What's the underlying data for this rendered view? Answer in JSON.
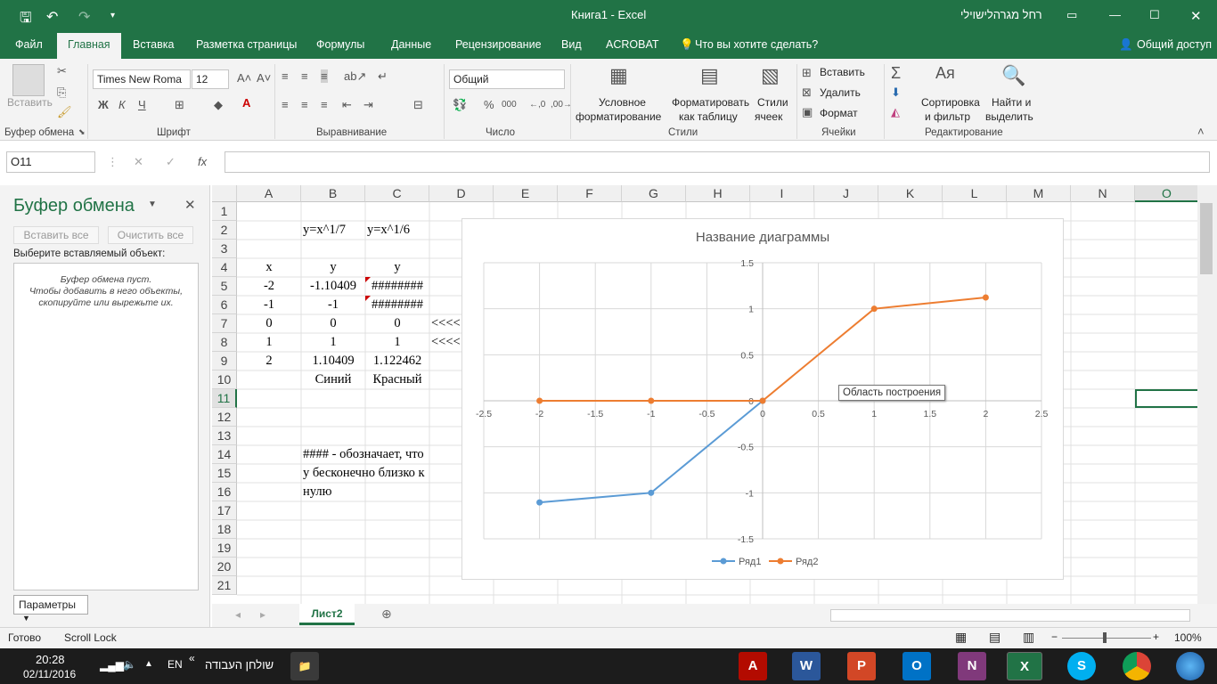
{
  "window": {
    "title": "Книга1  -  Excel",
    "user": "רחל מגרהלישוילי"
  },
  "tabs": [
    "Файл",
    "Главная",
    "Вставка",
    "Разметка страницы",
    "Формулы",
    "Данные",
    "Рецензирование",
    "Вид",
    "ACROBAT"
  ],
  "tell_me": "Что вы хотите сделать?",
  "share": "Общий доступ",
  "ribbon": {
    "paste": "Вставить",
    "font_name": "Times New Roma",
    "font_size": "12",
    "bold": "Ж",
    "italic": "К",
    "underline": "Ч",
    "number_format": "Общий",
    "cond_format_1": "Условное",
    "cond_format_2": "форматирование",
    "format_table_1": "Форматировать",
    "format_table_2": "как таблицу",
    "cell_styles_1": "Стили",
    "cell_styles_2": "ячеек",
    "insert": "Вставить",
    "delete": "Удалить",
    "format": "Формат",
    "sort_1": "Сортировка",
    "sort_2": "и фильтр",
    "find_1": "Найти и",
    "find_2": "выделить",
    "groups": {
      "clipboard": "Буфер обмена",
      "font": "Шрифт",
      "alignment": "Выравнивание",
      "number": "Число",
      "styles": "Стили",
      "cells": "Ячейки",
      "editing": "Редактирование"
    }
  },
  "namebox": "O11",
  "formula": "",
  "clipboard_pane": {
    "title": "Буфер обмена",
    "paste_all": "Вставить все",
    "clear_all": "Очистить все",
    "select_label": "Выберите вставляемый объект:",
    "empty_1": "Буфер обмена пуст.",
    "empty_2": "Чтобы добавить в него объекты,",
    "empty_3": "скопируйте или вырежьте их.",
    "options": "Параметры"
  },
  "columns": [
    "A",
    "B",
    "C",
    "D",
    "E",
    "F",
    "G",
    "H",
    "I",
    "J",
    "K",
    "L",
    "M",
    "N",
    "O"
  ],
  "rows": [
    "1",
    "2",
    "3",
    "4",
    "5",
    "6",
    "7",
    "8",
    "9",
    "10",
    "11",
    "12",
    "13",
    "14",
    "15",
    "16",
    "17",
    "18",
    "19",
    "20",
    "21"
  ],
  "cells": {
    "B2": "y=x^1/7",
    "C2": "y=x^1/6",
    "A4": "x",
    "B4": "y",
    "C4": "y",
    "A5": "-2",
    "B5": "-1.10409",
    "C5": "########",
    "A6": "-1",
    "B6": "-1",
    "C6": "########",
    "A7": "0",
    "B7": "0",
    "C7": "0",
    "D7": "<<<<",
    "A8": "1",
    "B8": "1",
    "C8": "1",
    "D8": "<<<<",
    "A9": "2",
    "B9": "1.10409",
    "C9": "1.122462",
    "B10": "Синий",
    "C10": "Красный",
    "B14": "#### - обозначает, что",
    "B15": "у бесконечно близко к",
    "B16": "нулю"
  },
  "chart_data": {
    "type": "scatter",
    "title": "Название диаграммы",
    "xlim": [
      -2.5,
      2.5
    ],
    "ylim": [
      -1.5,
      1.5
    ],
    "xticks": [
      "-2.5",
      "-2",
      "-1.5",
      "-1",
      "-0.5",
      "0",
      "0.5",
      "1",
      "1.5",
      "2",
      "2.5"
    ],
    "yticks": [
      "1.5",
      "1",
      "0.5",
      "0",
      "-0.5",
      "-1",
      "-1.5"
    ],
    "grid": true,
    "legend": "bottom",
    "series": [
      {
        "name": "Ряд1",
        "color": "#5b9bd5",
        "x": [
          -2,
          -1,
          0
        ],
        "y": [
          -1.10409,
          -1,
          0
        ]
      },
      {
        "name": "Ряд2",
        "color": "#ed7d31",
        "x": [
          -2,
          -1,
          0,
          1,
          2
        ],
        "y": [
          0,
          0,
          0,
          1,
          1.122462
        ]
      }
    ],
    "tooltip": "Область построения"
  },
  "sheet_tab": "Лист2",
  "status": {
    "ready": "Готово",
    "scroll_lock": "Scroll Lock",
    "zoom": "100%"
  },
  "taskbar": {
    "time": "20:28",
    "date": "02/11/2016",
    "lang": "EN",
    "desktop": "שולחן העבודה"
  }
}
